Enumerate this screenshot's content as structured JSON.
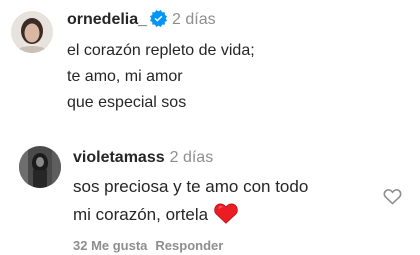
{
  "comments": [
    {
      "username": "ornedelia_",
      "verified": true,
      "time": "2 días",
      "lines": [
        "el corazón repleto de vida;",
        "te amo, mi amor",
        "que especial sos"
      ],
      "avatar_icon": "profile-photo"
    },
    {
      "username": "violetamass",
      "verified": false,
      "time": "2 días",
      "lines": [
        "sos preciosa y te amo con todo",
        "mi corazón, ortela"
      ],
      "trailing_emoji": "red-heart-icon",
      "likes_label": "32 Me gusta",
      "reply_label": "Responder",
      "avatar_icon": "profile-photo"
    }
  ],
  "colors": {
    "text": "#262626",
    "muted": "#8e8e8e",
    "verified_blue": "#0095f6",
    "heart_red": "#ed1c24"
  }
}
